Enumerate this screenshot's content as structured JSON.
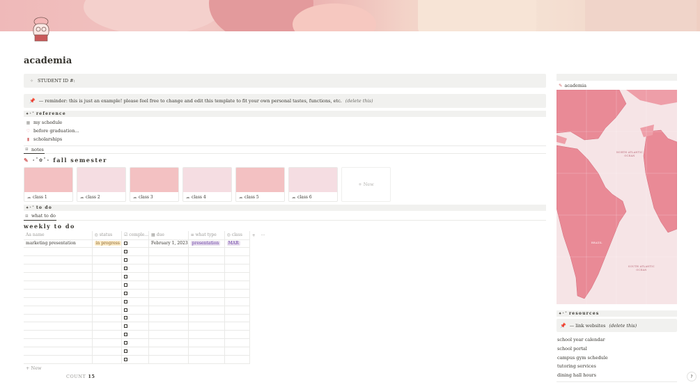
{
  "page": {
    "title": "academia"
  },
  "student": {
    "label": "STUDENT ID #:"
  },
  "reminder": {
    "text": "— reminder: this is just an example! please feel free to change and edit this template to fit your own personal tastes, functions, etc.",
    "note": "(delete this)"
  },
  "reference": {
    "heading": "reference",
    "links": [
      {
        "label": "my schedule",
        "icon": "calendar-icon"
      },
      {
        "label": "before graduation...",
        "icon": "heart-icon"
      },
      {
        "label": "scholarships",
        "icon": "bookmark-icon"
      }
    ]
  },
  "notes_tab": {
    "label": "notes"
  },
  "semester": {
    "heading": "fall semester",
    "classes": [
      {
        "label": "class 1",
        "color": "#f3c1c2"
      },
      {
        "label": "class 2",
        "color": "#f5dde2"
      },
      {
        "label": "class 3",
        "color": "#f3c1c2"
      },
      {
        "label": "class 4",
        "color": "#f5dde2"
      },
      {
        "label": "class 5",
        "color": "#f3c1c2"
      },
      {
        "label": "class 6",
        "color": "#f5dde2"
      }
    ],
    "new_label": "+ New"
  },
  "todo": {
    "heading": "to do",
    "tab_label": "what to do",
    "title": "weekly to do"
  },
  "table": {
    "columns": [
      {
        "label": "name",
        "icon": "Aa"
      },
      {
        "label": "status",
        "icon": "◎"
      },
      {
        "label": "comple...",
        "icon": "☑"
      },
      {
        "label": "due",
        "icon": "▦"
      },
      {
        "label": "what type",
        "icon": "≡"
      },
      {
        "label": "class",
        "icon": "◎"
      }
    ],
    "add_symbol": "+",
    "more_symbol": "···",
    "rows": [
      {
        "name": "marketing presentation",
        "status": "in progress",
        "due": "February 1, 2023",
        "type": "presentation",
        "class": "MAR"
      }
    ],
    "empty_rows": 14,
    "new_label": "+ New",
    "count_label": "COUNT",
    "count_value": "15"
  },
  "sidebar": {
    "page_link": "academia",
    "resources_heading": "resources",
    "link_callout": "— link websites",
    "link_note": "(delete this)",
    "links": [
      "school year calendar",
      "school portal",
      "campus gym schedule",
      "tutoring services",
      "dining hall hours"
    ],
    "map_labels": [
      "NORTH ATLANTIC OCEAN",
      "BRAZIL",
      "SOUTH ATLANTIC OCEAN"
    ]
  },
  "help": {
    "label": "?"
  },
  "colors": {
    "status_bg": "#fdecc8",
    "status_fg": "#89632a",
    "type_bg": "#e8deee",
    "type_fg": "#6940a5",
    "class_bg": "#e8deee",
    "class_fg": "#6940a5",
    "map_land": "#e98a96",
    "map_sea": "#f6e4e6"
  }
}
